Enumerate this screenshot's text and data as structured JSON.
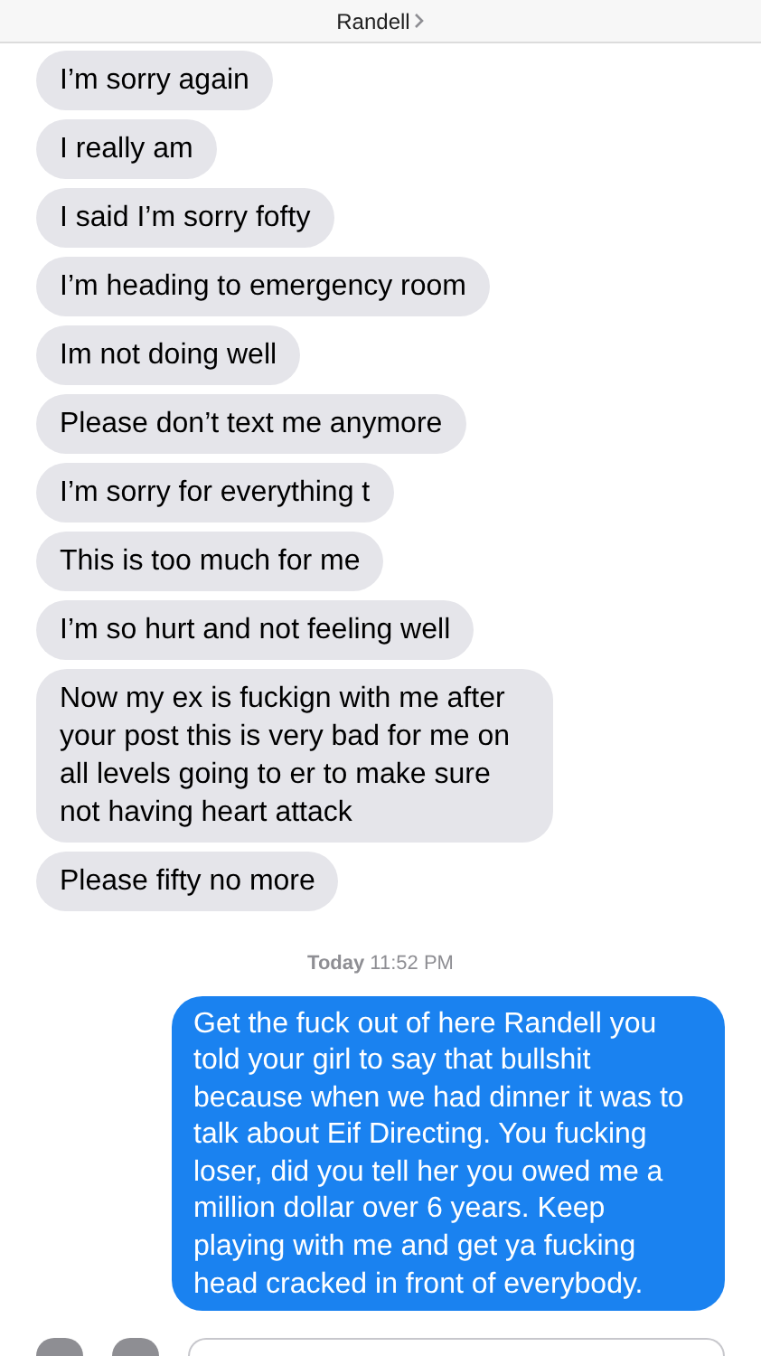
{
  "header": {
    "contact": "Randell"
  },
  "messages": [
    {
      "kind": "incoming",
      "text": "I’m sorry again"
    },
    {
      "kind": "incoming",
      "text": "I really am"
    },
    {
      "kind": "incoming",
      "text": "I said I’m sorry fofty"
    },
    {
      "kind": "incoming",
      "text": "I’m heading to emergency room"
    },
    {
      "kind": "incoming",
      "text": "Im not doing well"
    },
    {
      "kind": "incoming",
      "text": "Please don’t text me anymore"
    },
    {
      "kind": "incoming",
      "text": "I’m sorry for everything t"
    },
    {
      "kind": "incoming",
      "text": "This is too much for me"
    },
    {
      "kind": "incoming",
      "text": "I’m so hurt and not feeling well"
    },
    {
      "kind": "incoming",
      "text": "Now my ex is fuckign with me after your post this is very bad for me on all levels going to er to make sure not having heart attack"
    },
    {
      "kind": "incoming",
      "text": "Please fifty no more"
    },
    {
      "kind": "timestamp",
      "text": "**Today** 11:52 PM"
    },
    {
      "kind": "outgoing",
      "text": "Get the fuck out of here Randell you told your girl to say that bullshit because when we had dinner it was to talk about Eif Directing. You fucking loser, did you tell her you owed me a million dollar over 6 years. Keep playing with me and get ya fucking head cracked in front of everybody."
    }
  ]
}
